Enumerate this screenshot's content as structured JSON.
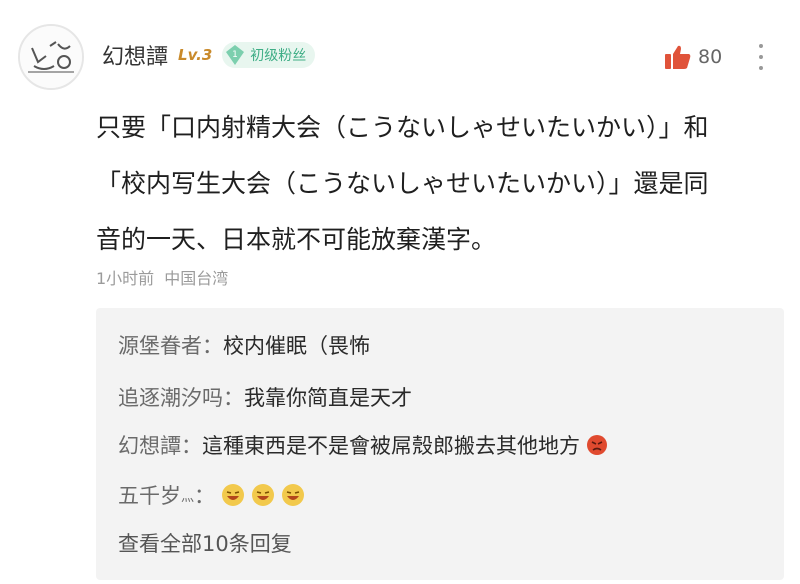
{
  "comment": {
    "username": "幻想譚",
    "level": "Lv.3",
    "fan_badge": "初级粉丝",
    "fan_badge_level": "1",
    "like_count": "80",
    "content_lines": [
      "只要「口内射精大会（こうないしゃせいたいかい）」和",
      "「校内写生大会（こうないしゃせいたいかい）」還是同",
      "音的一天、日本就不可能放棄漢字。"
    ],
    "time": "1小时前",
    "location": "中国台湾"
  },
  "replies": [
    {
      "author": "源堡眷者：",
      "text": "校内催眠（畏怖"
    },
    {
      "author": "追逐潮汐吗：",
      "text": "我靠你简直是天才"
    },
    {
      "author": "幻想譚：",
      "text": "這種東西是不是會被屌殼郎搬去其他地方"
    },
    {
      "author": "五千岁",
      "author_suffix": "灬",
      "colon": "："
    }
  ],
  "view_all": "查看全部10条回复",
  "icons": {
    "avatar": "avatar-doodle",
    "like": "thumbs-up-icon",
    "more": "more-vertical-icon",
    "fan": "gem-icon"
  },
  "colors": {
    "like": "#e0533a",
    "badge_text": "#3fae86",
    "level": "#c98a2b"
  }
}
